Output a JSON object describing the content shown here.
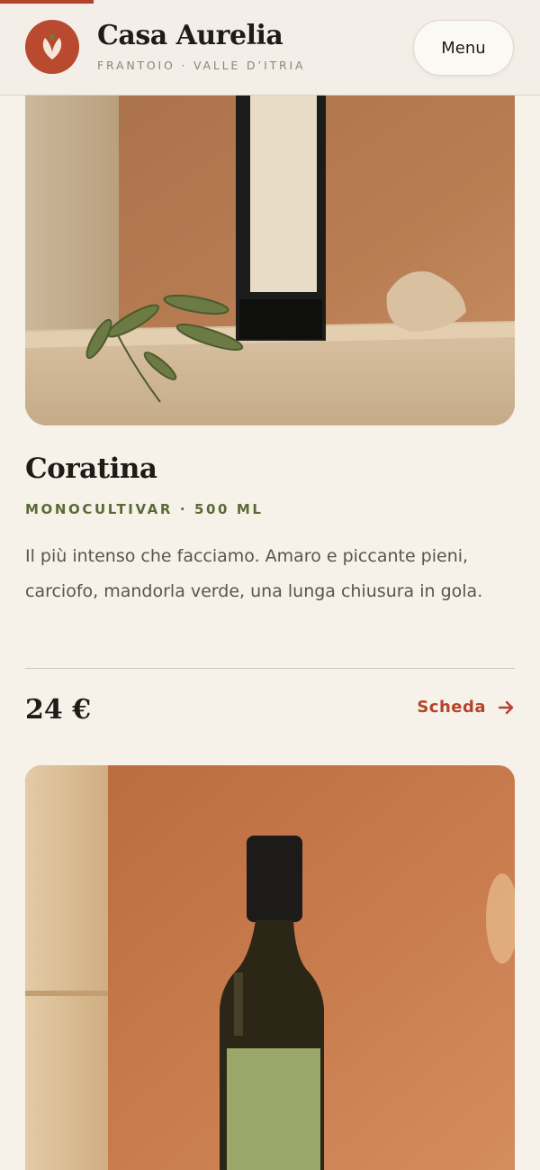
{
  "header": {
    "brand_title": "Casa Aurelia",
    "brand_subtitle": "FRANTOIO · VALLE D’ITRIA",
    "menu_label": "Menu",
    "logo_icon": "olive-leaf-icon"
  },
  "colors": {
    "accent": "#b5432a",
    "olive": "#5b6a34",
    "background": "#f6f2ea"
  },
  "products": [
    {
      "name": "Coratina",
      "meta": "MONOCULTIVAR · 500 ML",
      "description": "Il più intenso che facciamo. Amaro e piccante pieni, carciofo, mandorla verde, una lunga chiusura in gola.",
      "price": "24 €",
      "link_label": "Scheda",
      "link_icon": "arrow-right-icon"
    }
  ]
}
